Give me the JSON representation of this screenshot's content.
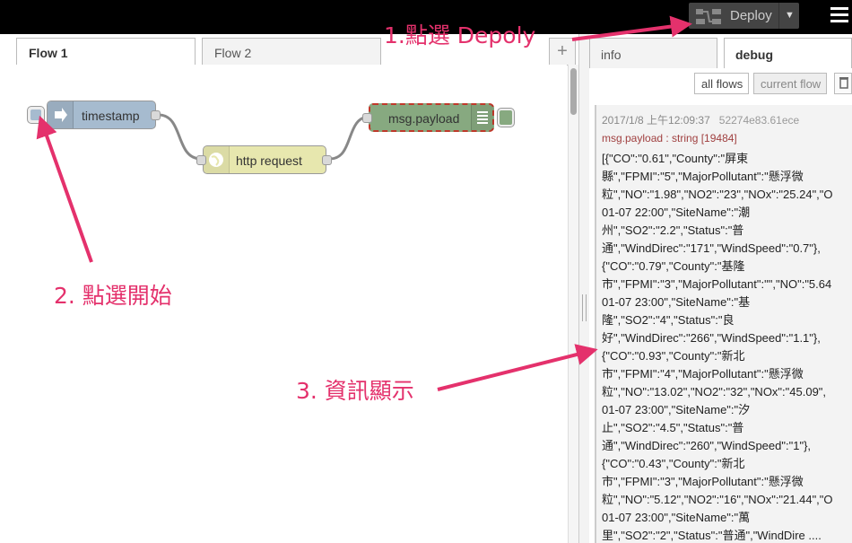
{
  "header": {
    "deploy_label": "Deploy",
    "deploy_caret": "▼"
  },
  "workspace": {
    "tabs": [
      {
        "label": "Flow 1",
        "active": true
      },
      {
        "label": "Flow 2",
        "active": false
      }
    ],
    "add_tab": "+"
  },
  "nodes": {
    "inject": {
      "label": "timestamp",
      "color": "#a6bbcf"
    },
    "http": {
      "label": "http request",
      "color": "#e7e7ae"
    },
    "debug": {
      "label": "msg.payload",
      "color": "#87a980"
    }
  },
  "sidebar": {
    "tabs": [
      {
        "label": "info",
        "active": false
      },
      {
        "label": "debug",
        "active": true
      }
    ],
    "filter_all": "all flows",
    "filter_current": "current flow",
    "message": {
      "timestamp": "2017/1/8 上午12:09:37",
      "node_id": "52274e83.61ece",
      "type": "msg.payload : string [19484]",
      "lines": [
        "[{\"CO\":\"0.61\",\"County\":\"屏東",
        "縣\",\"FPMI\":\"5\",\"MajorPollutant\":\"懸浮微",
        "粒\",\"NO\":\"1.98\",\"NO2\":\"23\",\"NOx\":\"25.24\",\"O",
        "01-07 22:00\",\"SiteName\":\"潮",
        "州\",\"SO2\":\"2.2\",\"Status\":\"普",
        "通\",\"WindDirec\":\"171\",\"WindSpeed\":\"0.7\"},",
        "{\"CO\":\"0.79\",\"County\":\"基隆",
        "市\",\"FPMI\":\"3\",\"MajorPollutant\":\"\",\"NO\":\"5.64",
        "01-07 23:00\",\"SiteName\":\"基",
        "隆\",\"SO2\":\"4\",\"Status\":\"良",
        "好\",\"WindDirec\":\"266\",\"WindSpeed\":\"1.1\"},",
        "{\"CO\":\"0.93\",\"County\":\"新北",
        "市\",\"FPMI\":\"4\",\"MajorPollutant\":\"懸浮微",
        "粒\",\"NO\":\"13.02\",\"NO2\":\"32\",\"NOx\":\"45.09\",",
        "01-07 23:00\",\"SiteName\":\"汐",
        "止\",\"SO2\":\"4.5\",\"Status\":\"普",
        "通\",\"WindDirec\":\"260\",\"WindSpeed\":\"1\"},",
        "{\"CO\":\"0.43\",\"County\":\"新北",
        "市\",\"FPMI\":\"3\",\"MajorPollutant\":\"懸浮微",
        "粒\",\"NO\":\"5.12\",\"NO2\":\"16\",\"NOx\":\"21.44\",\"O",
        "01-07 23:00\",\"SiteName\":\"萬",
        "里\",\"SO2\":\"2\",\"Status\":\"普通\",\"WindDire ...."
      ]
    }
  },
  "annotations": {
    "step1": "1.點選 Depoly",
    "step2": "2. 點選開始",
    "step3": "3. 資訊顯示",
    "color": "#e4316c"
  }
}
